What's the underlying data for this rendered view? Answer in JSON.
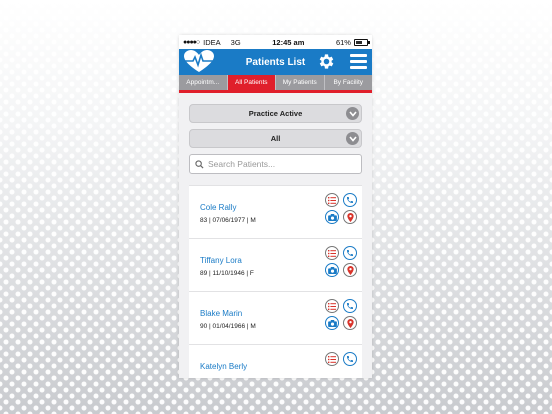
{
  "status": {
    "carrier": "IDEA",
    "network": "3G",
    "time": "12:45 am",
    "battery": "61%",
    "battery_level": 0.61
  },
  "header": {
    "title": "Patients List"
  },
  "tabs": [
    {
      "label": "Appointm..."
    },
    {
      "label": "All Patients",
      "active": true
    },
    {
      "label": "My Patients"
    },
    {
      "label": "By Facility"
    }
  ],
  "filters": {
    "practice": "Practice Active",
    "scope": "All"
  },
  "search": {
    "placeholder": "Search Patients..."
  },
  "patients": [
    {
      "name": "Cole Rally",
      "meta": "83 | 07/06/1977 | M"
    },
    {
      "name": "Tiffany Lora",
      "meta": "89 | 11/10/1946 | F"
    },
    {
      "name": "Blake Marin",
      "meta": "90 | 01/04/1966 | M"
    },
    {
      "name": "Katelyn Berly",
      "meta": ""
    }
  ],
  "colors": {
    "brand_blue": "#1a7bc6",
    "active_red": "#e01f2b",
    "tab_gray": "#9b9b9f"
  },
  "icons": [
    "heart-monitor-logo-icon",
    "gear-icon",
    "hamburger-menu-icon",
    "chevron-down-icon",
    "search-icon",
    "list-icon",
    "phone-icon",
    "camera-icon",
    "map-pin-icon"
  ]
}
